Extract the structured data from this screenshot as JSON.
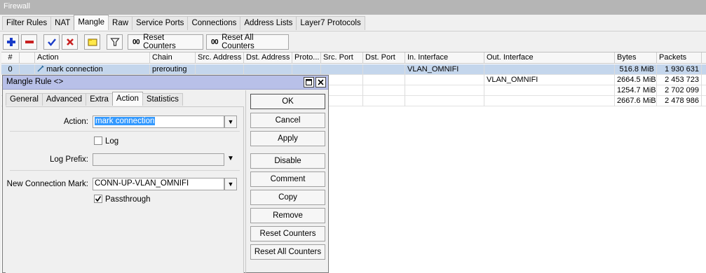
{
  "window": {
    "title": "Firewall"
  },
  "tabs": [
    "Filter Rules",
    "NAT",
    "Mangle",
    "Raw",
    "Service Ports",
    "Connections",
    "Address Lists",
    "Layer7 Protocols"
  ],
  "active_tab": "Mangle",
  "toolbar": {
    "reset_counters": "Reset Counters",
    "reset_all_counters": "Reset All Counters",
    "oo": "00",
    "icons": [
      "add-icon",
      "remove-icon",
      "enable-icon",
      "disable-icon",
      "comment-icon",
      "filter-icon"
    ],
    "colors": {
      "add": "#1a3cc8",
      "remove": "#c82020",
      "enable": "#1a3cc8",
      "disable": "#c82020"
    }
  },
  "grid": {
    "headers": [
      "#",
      "",
      "Action",
      "Chain",
      "Src. Address",
      "Dst. Address",
      "Proto...",
      "Src. Port",
      "Dst. Port",
      "In. Interface",
      "Out. Interface",
      "Bytes",
      "Packets"
    ],
    "rows": [
      {
        "num": "0",
        "action": "mark connection",
        "chain": "prerouting",
        "in_iface": "VLAN_OMNIFI",
        "out_iface": "",
        "bytes": "516.8 MiB",
        "packets": "1 930 631",
        "selected": true
      },
      {
        "num": "",
        "action": "",
        "chain": "",
        "in_iface": "",
        "out_iface": "VLAN_OMNIFI",
        "bytes": "2664.5 MiB",
        "packets": "2 453 723",
        "selected": false
      },
      {
        "num": "",
        "action": "",
        "chain": "",
        "in_iface": "",
        "out_iface": "",
        "bytes": "1254.7 MiB",
        "packets": "2 702 099",
        "selected": false
      },
      {
        "num": "",
        "action": "",
        "chain": "",
        "in_iface": "",
        "out_iface": "",
        "bytes": "2667.6 MiB",
        "packets": "2 478 986",
        "selected": false
      }
    ]
  },
  "dialog": {
    "title": "Mangle Rule <>",
    "tabs": [
      "General",
      "Advanced",
      "Extra",
      "Action",
      "Statistics"
    ],
    "active_tab": "Action",
    "fields": {
      "action_label": "Action:",
      "action_value": "mark connection",
      "log_label": "Log",
      "log_checked": false,
      "log_prefix_label": "Log Prefix:",
      "log_prefix_value": "",
      "new_conn_mark_label": "New Connection Mark:",
      "new_conn_mark_value": "CONN-UP-VLAN_OMNIFI",
      "passthrough_label": "Passthrough",
      "passthrough_checked": true
    },
    "buttons": [
      "OK",
      "Cancel",
      "Apply",
      "Disable",
      "Comment",
      "Copy",
      "Remove",
      "Reset Counters",
      "Reset All Counters"
    ]
  }
}
